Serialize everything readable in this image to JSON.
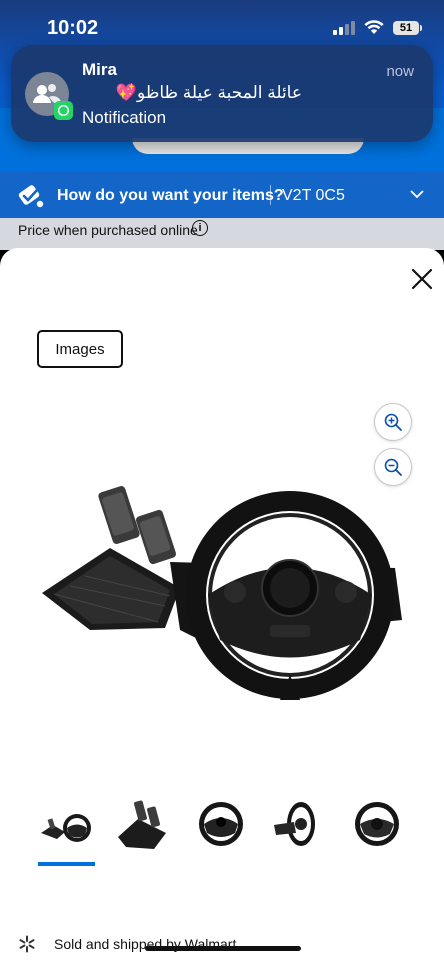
{
  "status_bar": {
    "time": "10:02",
    "battery": "51"
  },
  "notification": {
    "sender": "Mira",
    "time": "now",
    "message": "عائلة المحبة عيلة ظاظو💖",
    "subtitle": "Notification"
  },
  "delivery": {
    "question": "How do you want your items?",
    "zip": "V2T 0C5"
  },
  "price_note": {
    "text": "Price when purchased online",
    "info_glyph": "i"
  },
  "viewer": {
    "tab_label": "Images"
  },
  "thumbnails": [
    "wheel-and-pedals-front",
    "pedals",
    "wheel-front",
    "wheel-side",
    "wheel-back"
  ],
  "selected_thumbnail": 0,
  "fulfillment": {
    "text": "Sold and shipped by Walmart"
  },
  "colors": {
    "brand_blue": "#0071dc",
    "spark_yellow": "#ffc220"
  }
}
